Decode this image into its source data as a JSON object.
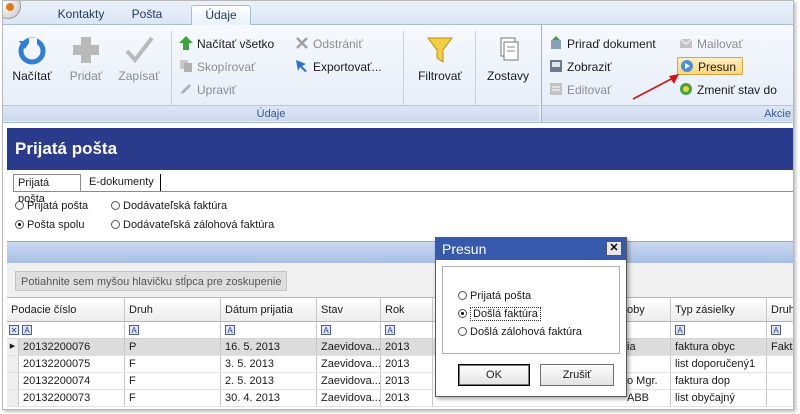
{
  "ribbon": {
    "tabs": [
      {
        "label": "Kontakty"
      },
      {
        "label": "Pošta"
      },
      {
        "label": "Údaje"
      }
    ],
    "udaje_group": {
      "label": "Údaje",
      "nacitat": "Načítať",
      "pridat": "Pridať",
      "zapisat": "Zapísať",
      "nacitat_vsetko": "Načítať všetko",
      "skopirovat": "Skopírovať",
      "upravit": "Upraviť",
      "odstranit": "Odstrániť",
      "exportovat": "Exportovať...",
      "filtrovat": "Filtrovať",
      "zostavy": "Zostavy"
    },
    "akcie_group": {
      "label": "Akcie",
      "priradit_dokument": "Priraď dokument",
      "zobrazit": "Zobraziť",
      "editovat": "Editovať",
      "mailovat": "Mailovať",
      "presun": "Presun",
      "zmenit_stav": "Zmeniť stav do"
    }
  },
  "page": {
    "title": "Prijatá pošta",
    "subtabs": [
      "Prijatá pošta",
      "E-dokumenty"
    ],
    "filters": {
      "prijata_posta": "Prijatá pošta",
      "posta_spolu": "Pošta spolu",
      "dodavatelska_faktura": "Dodávateľská faktúra",
      "dodavatelska_zalohova": "Dodávateľská zálohová faktúra",
      "selected": "Pošta spolu"
    },
    "group_hint": "Potiahnite sem myšou hlavičku stĺpca pre zoskupenie"
  },
  "grid": {
    "columns": [
      "Podacie číslo",
      "Druh",
      "Dátum prijatia",
      "Stav",
      "Rok",
      "",
      "oby",
      "Typ zásielky",
      "Druh"
    ],
    "rows": [
      {
        "cislo": "20132200076",
        "druh": "P",
        "datum": "16. 5. 2013",
        "stav": "Zaevidova...",
        "rok": "2013",
        "osoba": "ia",
        "typ": "faktura obyc",
        "druh2": "Faktú"
      },
      {
        "cislo": "20132200075",
        "druh": "F",
        "datum": "3. 5. 2013",
        "stav": "Zaevidova...",
        "rok": "2013",
        "osoba": "",
        "typ": "list doporučený1",
        "druh2": ""
      },
      {
        "cislo": "20132200074",
        "druh": "F",
        "datum": "2. 5. 2013",
        "stav": "Zaevidova...",
        "rok": "2013",
        "osoba": "o Mgr.",
        "typ": "faktura dop",
        "druh2": ""
      },
      {
        "cislo": "20132200073",
        "druh": "F",
        "datum": "30. 4. 2013",
        "stav": "Zaevidova...",
        "rok": "2013",
        "osoba": "ABB",
        "typ": "list obyčajný",
        "druh2": ""
      }
    ]
  },
  "dialog": {
    "title": "Presun",
    "close_glyph": "✕",
    "options": [
      "Prijatá pošta",
      "Došlá faktúra",
      "Došlá zálohová faktúra"
    ],
    "selected": "Došlá faktúra",
    "ok": "OK",
    "cancel": "Zrušiť"
  }
}
